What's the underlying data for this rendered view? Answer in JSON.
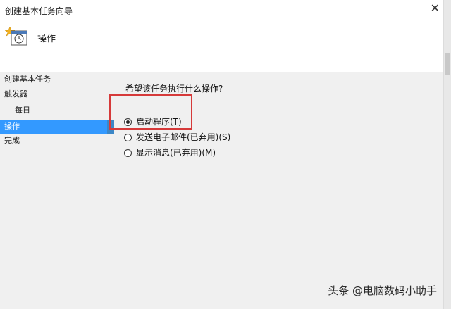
{
  "window": {
    "title": "创建基本任务向导",
    "close_glyph": "✕"
  },
  "header": {
    "title": "操作",
    "icon": "scheduled-task-icon"
  },
  "sidebar": {
    "items": [
      {
        "label": "创建基本任务"
      },
      {
        "label": "触发器"
      },
      {
        "label": "每日"
      },
      {
        "label": "操作"
      },
      {
        "label": "完成"
      }
    ]
  },
  "main": {
    "question": "希望该任务执行什么操作?",
    "options": [
      {
        "label": "启动程序(T)",
        "checked": true
      },
      {
        "label": "发送电子邮件(已弃用)(S)",
        "checked": false
      },
      {
        "label": "显示消息(已弃用)(M)",
        "checked": false
      }
    ]
  },
  "watermark": "头条 @电脑数码小助手",
  "colors": {
    "selection": "#3399ff",
    "highlight_box": "#d63a3a"
  }
}
